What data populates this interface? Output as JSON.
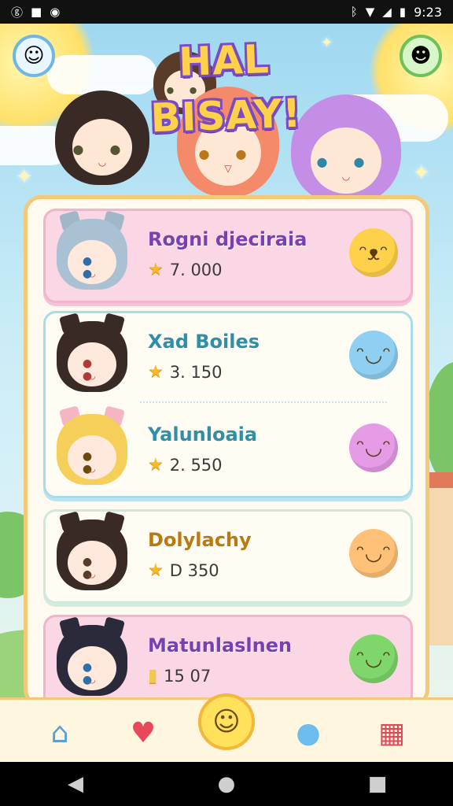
{
  "status_bar": {
    "time": "9:23",
    "left_icons": [
      "app-icon",
      "square-icon",
      "eye-icon"
    ],
    "right_icons": [
      "bluetooth-icon",
      "wifi-icon",
      "signal-icon",
      "battery-icon"
    ]
  },
  "header": {
    "title": "HAL BISAY!"
  },
  "leaderboard": [
    {
      "name": "Rogni djeciraia",
      "score": "7. 000",
      "score_icon": "star-icon",
      "mascot": "cat-face-mascot",
      "mascot_color": "#ffd14a",
      "card": "pink"
    },
    {
      "name": "Xad Boiles",
      "score": "3. 150",
      "score_icon": "star-icon",
      "mascot": "blue-blob-mascot",
      "mascot_color": "#8fd0f2",
      "card": "blue"
    },
    {
      "name": "Yalunloaia",
      "score": "2. 550",
      "score_icon": "star-icon",
      "mascot": "pink-blob-mascot",
      "mascot_color": "#e59be6",
      "card": "blue"
    },
    {
      "name": "Dolylachy",
      "score": "D 350",
      "score_icon": "star-icon",
      "mascot": "orange-hair-mascot",
      "mascot_color": "#ffc178",
      "card": "cream"
    },
    {
      "name": "Matunlaslnen",
      "score": "15 07",
      "score_icon": "note-icon",
      "mascot": "green-blob-mascot",
      "mascot_color": "#7fd66b",
      "card": "pink"
    }
  ],
  "bottom_nav": [
    "home-icon",
    "heart-icon",
    "smile-icon",
    "chat-bubble-icon",
    "calendar-icon"
  ],
  "colors": {
    "board_border": "#f3c878",
    "pink_card": "#fbd6e5",
    "title_fill": "#ffd04a",
    "title_outline": "#7a4bc4"
  }
}
